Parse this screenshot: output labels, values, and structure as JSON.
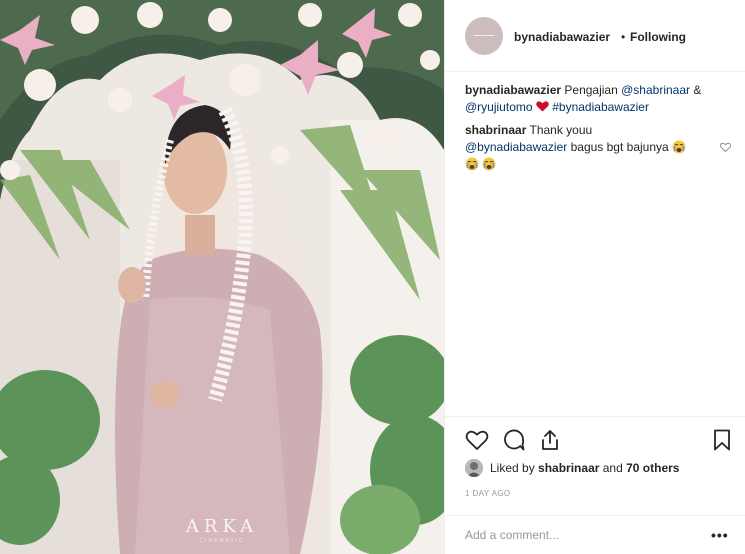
{
  "post": {
    "photo_alt": "Woman in pink lace kebaya with white lace veil in front of a floral arch",
    "watermark": "ARKA",
    "watermark_sub": "CINEMATIC"
  },
  "header": {
    "username": "bynadiabawazier",
    "separator": "•",
    "follow_status": "Following"
  },
  "caption": {
    "username": "bynadiabawazier",
    "text_1": "Pengajian",
    "mention_1": "@shabrinaar",
    "amp": "&",
    "mention_2": "@ryujiutomo",
    "hashtag": "#bynadiabawazier"
  },
  "comment": {
    "username": "shabrinaar",
    "text_1": "Thank youu",
    "mention": "@bynadiabawazier",
    "text_2": "bagus bgt bajunya"
  },
  "likes": {
    "prefix": "Liked by",
    "user": "shabrinaar",
    "joiner": "and",
    "others": "70 others"
  },
  "timestamp": "1 DAY AGO",
  "add_comment": {
    "placeholder": "Add a comment..."
  },
  "more_options": "•••",
  "icons": {
    "like": "heart-outline-icon",
    "comment": "speech-bubble-icon",
    "share": "share-upload-icon",
    "save": "bookmark-icon",
    "comment_like": "small-heart-icon"
  },
  "colors": {
    "text": "#262626",
    "link": "#003569",
    "muted": "#999999",
    "border": "#efefef",
    "heart_emoji": "#c8102e"
  }
}
